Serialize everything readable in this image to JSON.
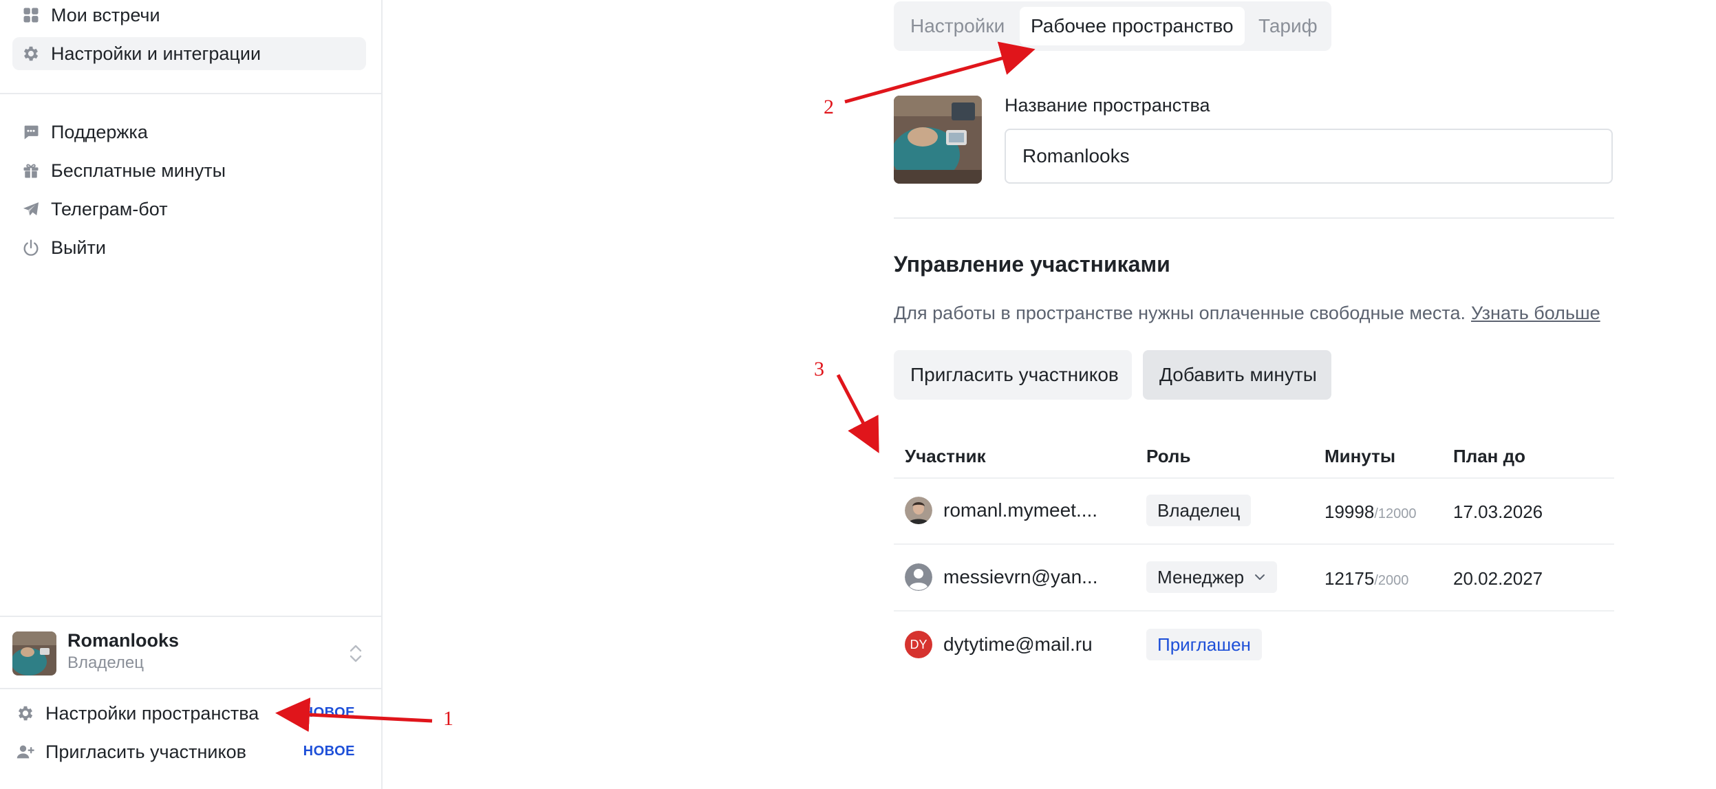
{
  "sidebar": {
    "items_top": [
      {
        "label": "Мои встречи",
        "icon": "grid-icon"
      },
      {
        "label": "Настройки и интеграции",
        "icon": "gear-icon",
        "active": true
      }
    ],
    "items_middle": [
      {
        "label": "Поддержка",
        "icon": "chat-bubble-icon"
      },
      {
        "label": "Бесплатные минуты",
        "icon": "gift-icon"
      },
      {
        "label": "Телеграм-бот",
        "icon": "telegram-icon"
      },
      {
        "label": "Выйти",
        "icon": "power-icon"
      }
    ],
    "workspace": {
      "name": "Romanlooks",
      "role": "Владелец"
    },
    "items_bottom": [
      {
        "label": "Настройки пространства",
        "badge": "НОВОЕ",
        "icon": "gear-icon"
      },
      {
        "label": "Пригласить участников",
        "badge": "НОВОЕ",
        "icon": "add-user-icon"
      }
    ]
  },
  "tabs": [
    {
      "label": "Настройки",
      "active": false
    },
    {
      "label": "Рабочее пространство",
      "active": true
    },
    {
      "label": "Тариф",
      "active": false
    }
  ],
  "workspace_form": {
    "name_label": "Название пространства",
    "name_value": "Romanlooks"
  },
  "members": {
    "title": "Управление участниками",
    "description": "Для работы в пространстве нужны оплаченные свободные места.",
    "learn_more": "Узнать больше",
    "invite_button": "Пригласить участников",
    "add_minutes_button": "Добавить минуты",
    "columns": [
      "Участник",
      "Роль",
      "Минуты",
      "План до"
    ],
    "rows": [
      {
        "email": "romanl.mymeet....",
        "role": "Владелец",
        "minutes_used": "19998",
        "minutes_total": "/12000",
        "plan_until": "17.03.2026",
        "avatar": "photo"
      },
      {
        "email": "messievrn@yan...",
        "role": "Менеджер",
        "minutes_used": "12175",
        "minutes_total": "/2000",
        "plan_until": "20.02.2027",
        "avatar": "default-user"
      },
      {
        "email": "dytytime@mail.ru",
        "role": "Приглашен",
        "minutes_used": "",
        "minutes_total": "",
        "plan_until": "",
        "avatar": "initials",
        "initials": "DY"
      }
    ]
  },
  "annotations": [
    "1",
    "2",
    "3"
  ],
  "colors": {
    "accent_blue": "#1d4fd8",
    "annotation_red": "#e0151b",
    "initials_avatar": "#d6332f"
  }
}
